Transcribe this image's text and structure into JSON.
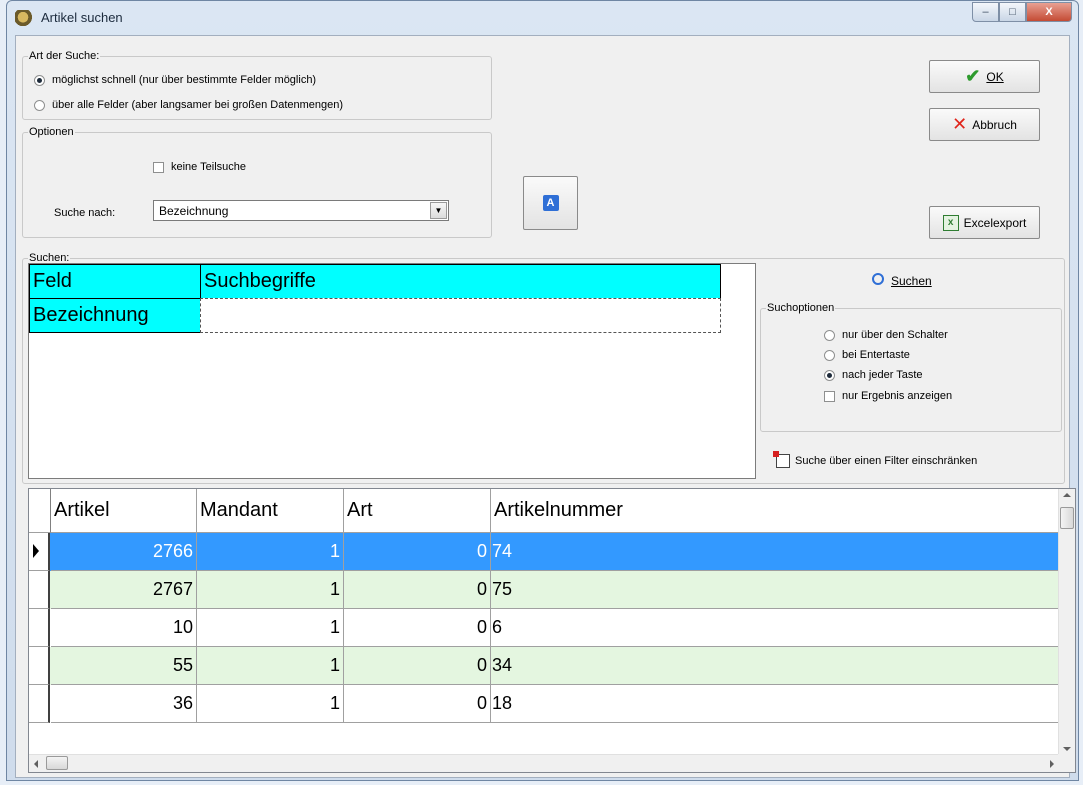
{
  "window": {
    "title": "Artikel suchen",
    "controls": {
      "minimize": "–",
      "maximize": "□",
      "close": "X"
    }
  },
  "art_der_suche": {
    "legend": "Art der Suche:",
    "option_fast": "möglichst schnell (nur über bestimmte Felder möglich)",
    "option_all": "über alle Felder (aber langsamer bei großen Datenmengen)",
    "selected": "option_fast"
  },
  "optionen": {
    "legend": "Optionen",
    "keine_teilsuche": "keine Teilsuche",
    "keine_teilsuche_checked": false,
    "suche_nach_label": "Suche nach:",
    "suche_nach_value": "Bezeichnung"
  },
  "buttons": {
    "ok": "OK",
    "abbruch": "Abbruch",
    "excelexport": "Excelexport",
    "font_button": "A"
  },
  "suchen_panel": {
    "legend": "Suchen:",
    "header_feld": "Feld",
    "header_suchbegriffe": "Suchbegriffe",
    "row_feld": "Bezeichnung",
    "row_value": ""
  },
  "right_panel": {
    "suchen_button": "Suchen",
    "suchoptionen_legend": "Suchoptionen",
    "opt_schalter": "nur über den Schalter",
    "opt_entertaste": "bei Entertaste",
    "opt_jeder_taste": "nach jeder Taste",
    "opt_nur_ergebnis": "nur Ergebnis anzeigen",
    "selected": "opt_jeder_taste",
    "filter_link": "Suche über einen Filter einschränken"
  },
  "grid": {
    "columns": [
      "Artikel",
      "Mandant",
      "Art",
      "Artikelnummer"
    ],
    "rows": [
      [
        "2766",
        "1",
        "0",
        "74"
      ],
      [
        "2767",
        "1",
        "0",
        "75"
      ],
      [
        "10",
        "1",
        "0",
        "6"
      ],
      [
        "55",
        "1",
        "0",
        "34"
      ],
      [
        "36",
        "1",
        "0",
        "18"
      ]
    ],
    "selected_row": 0
  },
  "colors": {
    "cyan": "#00ffff",
    "selection": "#3399ff",
    "alt_row": "#e4f6e0",
    "ok_check": "#2e9b2e",
    "cancel_x": "#e0251b"
  }
}
